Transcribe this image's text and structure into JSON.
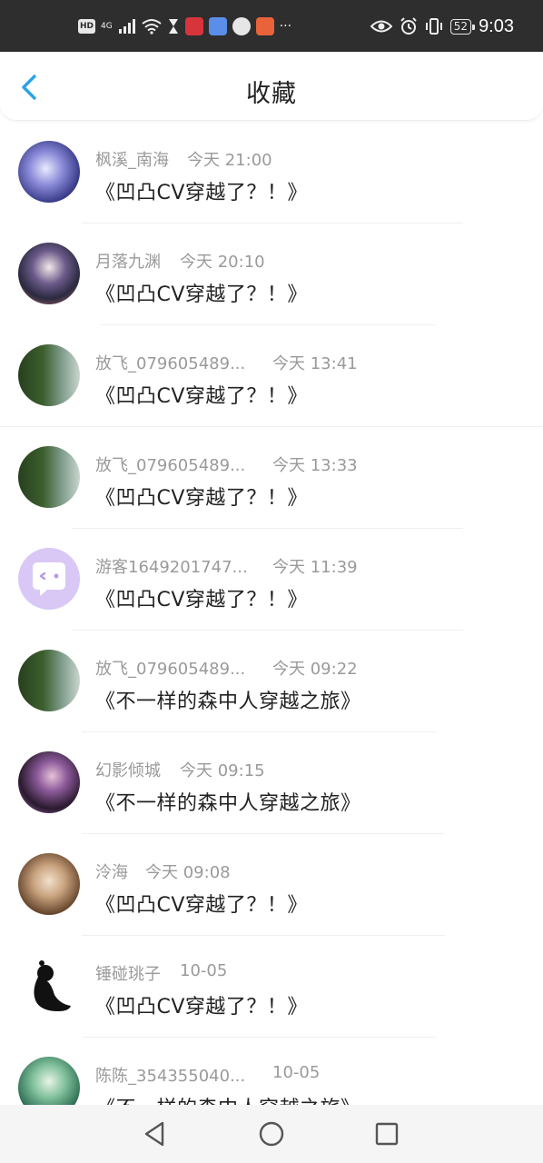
{
  "status_bar": {
    "left_badge": "HD",
    "network": "4G",
    "time": "9:03",
    "battery": "52"
  },
  "header": {
    "title": "收藏",
    "back_icon": "chevron-left-icon"
  },
  "colors": {
    "accent": "#2aa3e8",
    "primary_text": "#222222",
    "secondary_text": "#9a9a9a",
    "status_bar_bg": "#2e2e2e"
  },
  "favorites": [
    {
      "user": "枫溪_南海",
      "time": "今天 21:00",
      "work": "《凹凸CV穿越了？！》"
    },
    {
      "user": "月落九渊",
      "time": "今天 20:10",
      "work": "《凹凸CV穿越了？！》"
    },
    {
      "user": "放飞_079605489...",
      "time": "今天 13:41",
      "work": "《凹凸CV穿越了？！》"
    },
    {
      "user": "放飞_079605489...",
      "time": "今天 13:33",
      "work": "《凹凸CV穿越了？！》"
    },
    {
      "user": "游客1649201747...",
      "time": "今天 11:39",
      "work": "《凹凸CV穿越了？！》"
    },
    {
      "user": "放飞_079605489...",
      "time": "今天 09:22",
      "work": "《不一样的森中人穿越之旅》"
    },
    {
      "user": "幻影倾城",
      "time": "今天 09:15",
      "work": "《不一样的森中人穿越之旅》"
    },
    {
      "user": "泠海",
      "time": "今天 09:08",
      "work": "《凹凸CV穿越了？！》"
    },
    {
      "user": "锤碰珧子",
      "time": "10-05",
      "work": "《凹凸CV穿越了？！》"
    },
    {
      "user": "陈陈_354355040...",
      "time": "10-05",
      "work": "《不一样的森中人穿越之旅》"
    }
  ],
  "nav": {
    "back": "triangle-back-icon",
    "home": "circle-home-icon",
    "recents": "square-recents-icon"
  }
}
